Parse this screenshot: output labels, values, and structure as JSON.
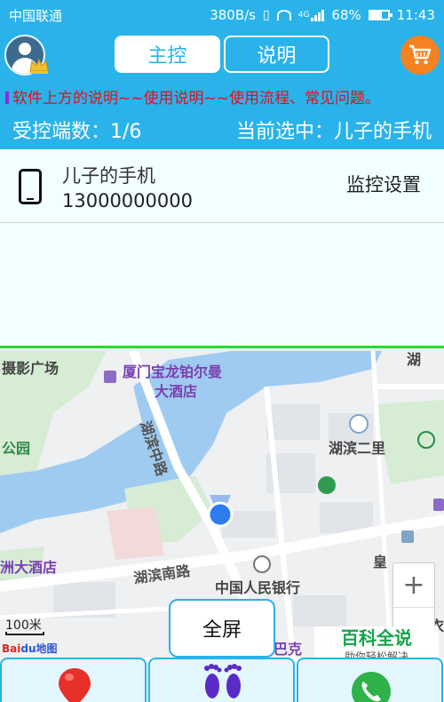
{
  "status_bar": {
    "carrier": "中国联通",
    "speed": "380B/s",
    "network": "4G",
    "battery": "68%",
    "battery_level": 0.68,
    "time": "11:43"
  },
  "header": {
    "tabs": [
      {
        "label": "主控",
        "active": true
      },
      {
        "label": "说明",
        "active": false
      }
    ],
    "marquee": "软件上方的说明~~使用说明~~使用流程、常见问题。",
    "controlled_count_label": "受控端数：1/6",
    "current_selected_label": "当前选中：儿子的手机",
    "accent_color": "#29b3ea",
    "marquee_color": "#e0101a"
  },
  "devices": [
    {
      "name": "儿子的手机",
      "number": "13000000000",
      "action_label": "监控设置"
    }
  ],
  "map": {
    "labels": {
      "photo_square": "摄影广场",
      "hotel_name_line1": "厦门宝龙铂尔曼",
      "hotel_name_line2": "大酒店",
      "park": "公园",
      "hubin_zhong_road": "湖滨中路",
      "hubin_er_li": "湖滨二里",
      "zhou_hotel": "洲大酒店",
      "hubin_nan_road": "湖滨南路",
      "bank": "中国人民银行",
      "huang": "皇",
      "xiamen_ba": "厦门巴克",
      "hu": "湖",
      "yi": "衣"
    },
    "scale_label": "100米",
    "logo_bai": "Bai",
    "logo_du": "du",
    "logo_ditu": "地图",
    "zoom_in_label": "+",
    "fullscreen_label": "全屏"
  },
  "watermark": {
    "title": "百科全说",
    "subtitle": "助你轻松解决"
  },
  "bottom_bar": {
    "buttons": [
      {
        "icon": "location-pin-icon"
      },
      {
        "icon": "footprints-icon"
      },
      {
        "icon": "phone-call-icon"
      }
    ]
  }
}
